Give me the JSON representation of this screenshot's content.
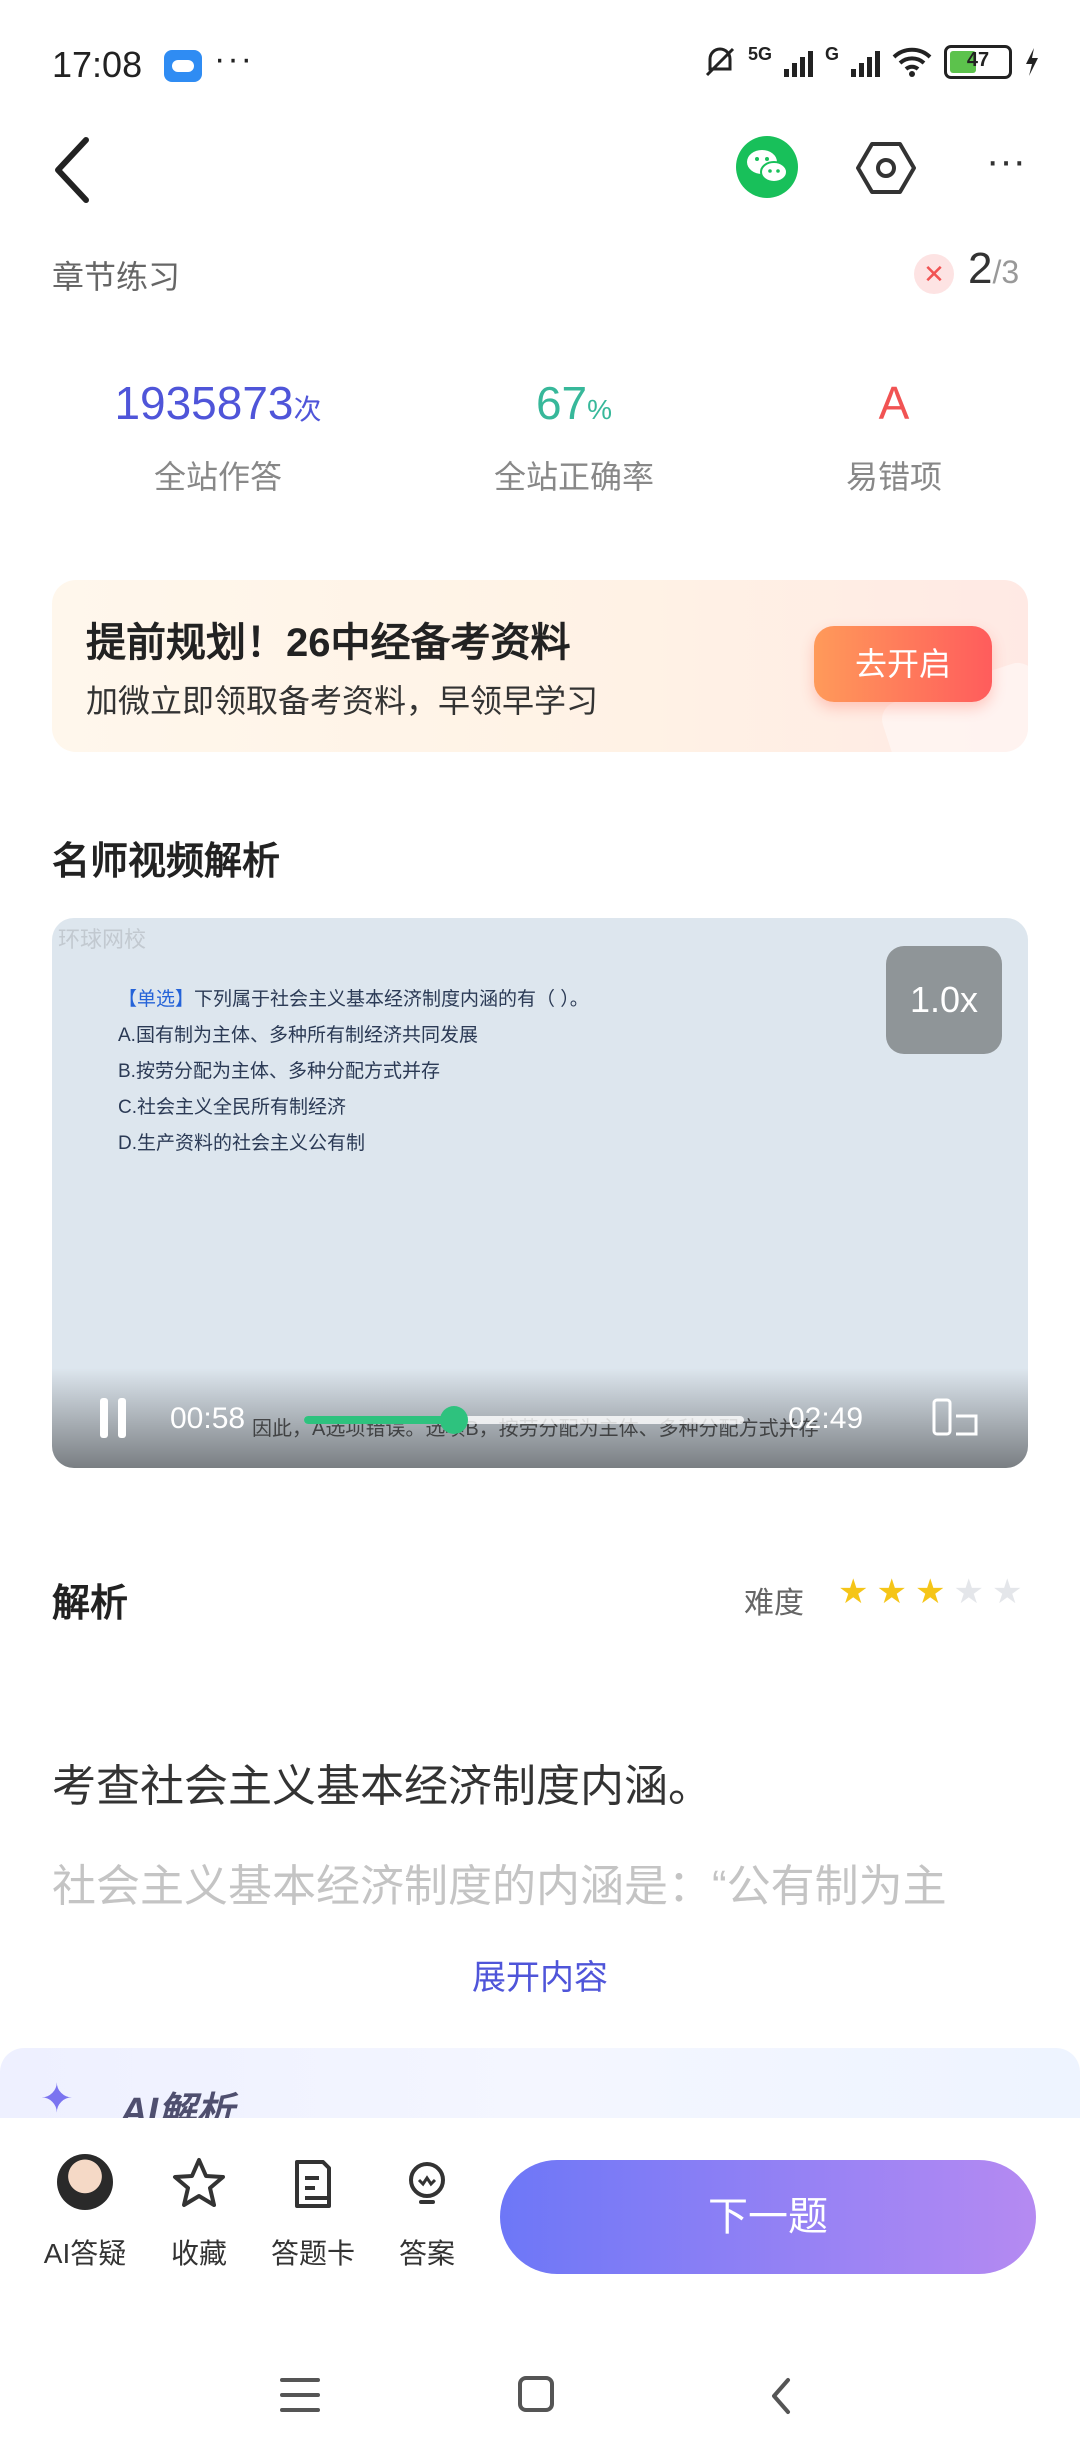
{
  "status_bar": {
    "time": "17:08",
    "dots": "···",
    "network": "5G",
    "network2": "G",
    "battery": "47"
  },
  "header": {
    "section_label": "章节练习",
    "current": "2",
    "total": "/3"
  },
  "stats": [
    {
      "value": "1935873",
      "unit": "次",
      "label": "全站作答",
      "color": "#4f55d9"
    },
    {
      "value": "67",
      "unit": "%",
      "label": "全站正确率",
      "color": "#37b89a"
    },
    {
      "value": "A",
      "unit": "",
      "label": "易错项",
      "color": "#f15353"
    }
  ],
  "banner": {
    "title": "提前规划！26中经备考资料",
    "subtitle": "加微立即领取备考资料，早领早学习",
    "button": "去开启"
  },
  "video_section": {
    "heading": "名师视频解析",
    "watermark": "环球网校",
    "speed": "1.0x",
    "question_tag": "【单选】",
    "question": "下列属于社会主义基本经济制度内涵的有（ ）。",
    "options": [
      "A.国有制为主体、多种所有制经济共同发展",
      "B.按劳分配为主体、多种分配方式并存",
      "C.社会主义全民所有制经济",
      "D.生产资料的社会主义公有制"
    ],
    "subtitle": "因此，A选项错误。选项B，按劳分配为主体、多种分配方式并存",
    "current_time": "00:58",
    "duration": "02:49",
    "progress": 0.34
  },
  "analysis": {
    "title": "解析",
    "difficulty_label": "难度",
    "difficulty": 3,
    "difficulty_max": 5,
    "main": "考查社会主义基本经济制度内涵。",
    "more": "社会主义基本经济制度的内涵是：“公有制为主",
    "expand": "展开内容"
  },
  "ai": {
    "title": "AI解析"
  },
  "toolbar": {
    "items": [
      {
        "label": "AI答疑",
        "icon": "avatar-icon"
      },
      {
        "label": "收藏",
        "icon": "star-icon"
      },
      {
        "label": "答题卡",
        "icon": "answer-sheet-icon"
      },
      {
        "label": "答案",
        "icon": "lightbulb-icon"
      }
    ],
    "next": "下一题"
  },
  "colors": {
    "accent": "#4f55d9",
    "green": "#2ec27e",
    "star": "#f5c518",
    "star_off": "#e4e6ea"
  }
}
